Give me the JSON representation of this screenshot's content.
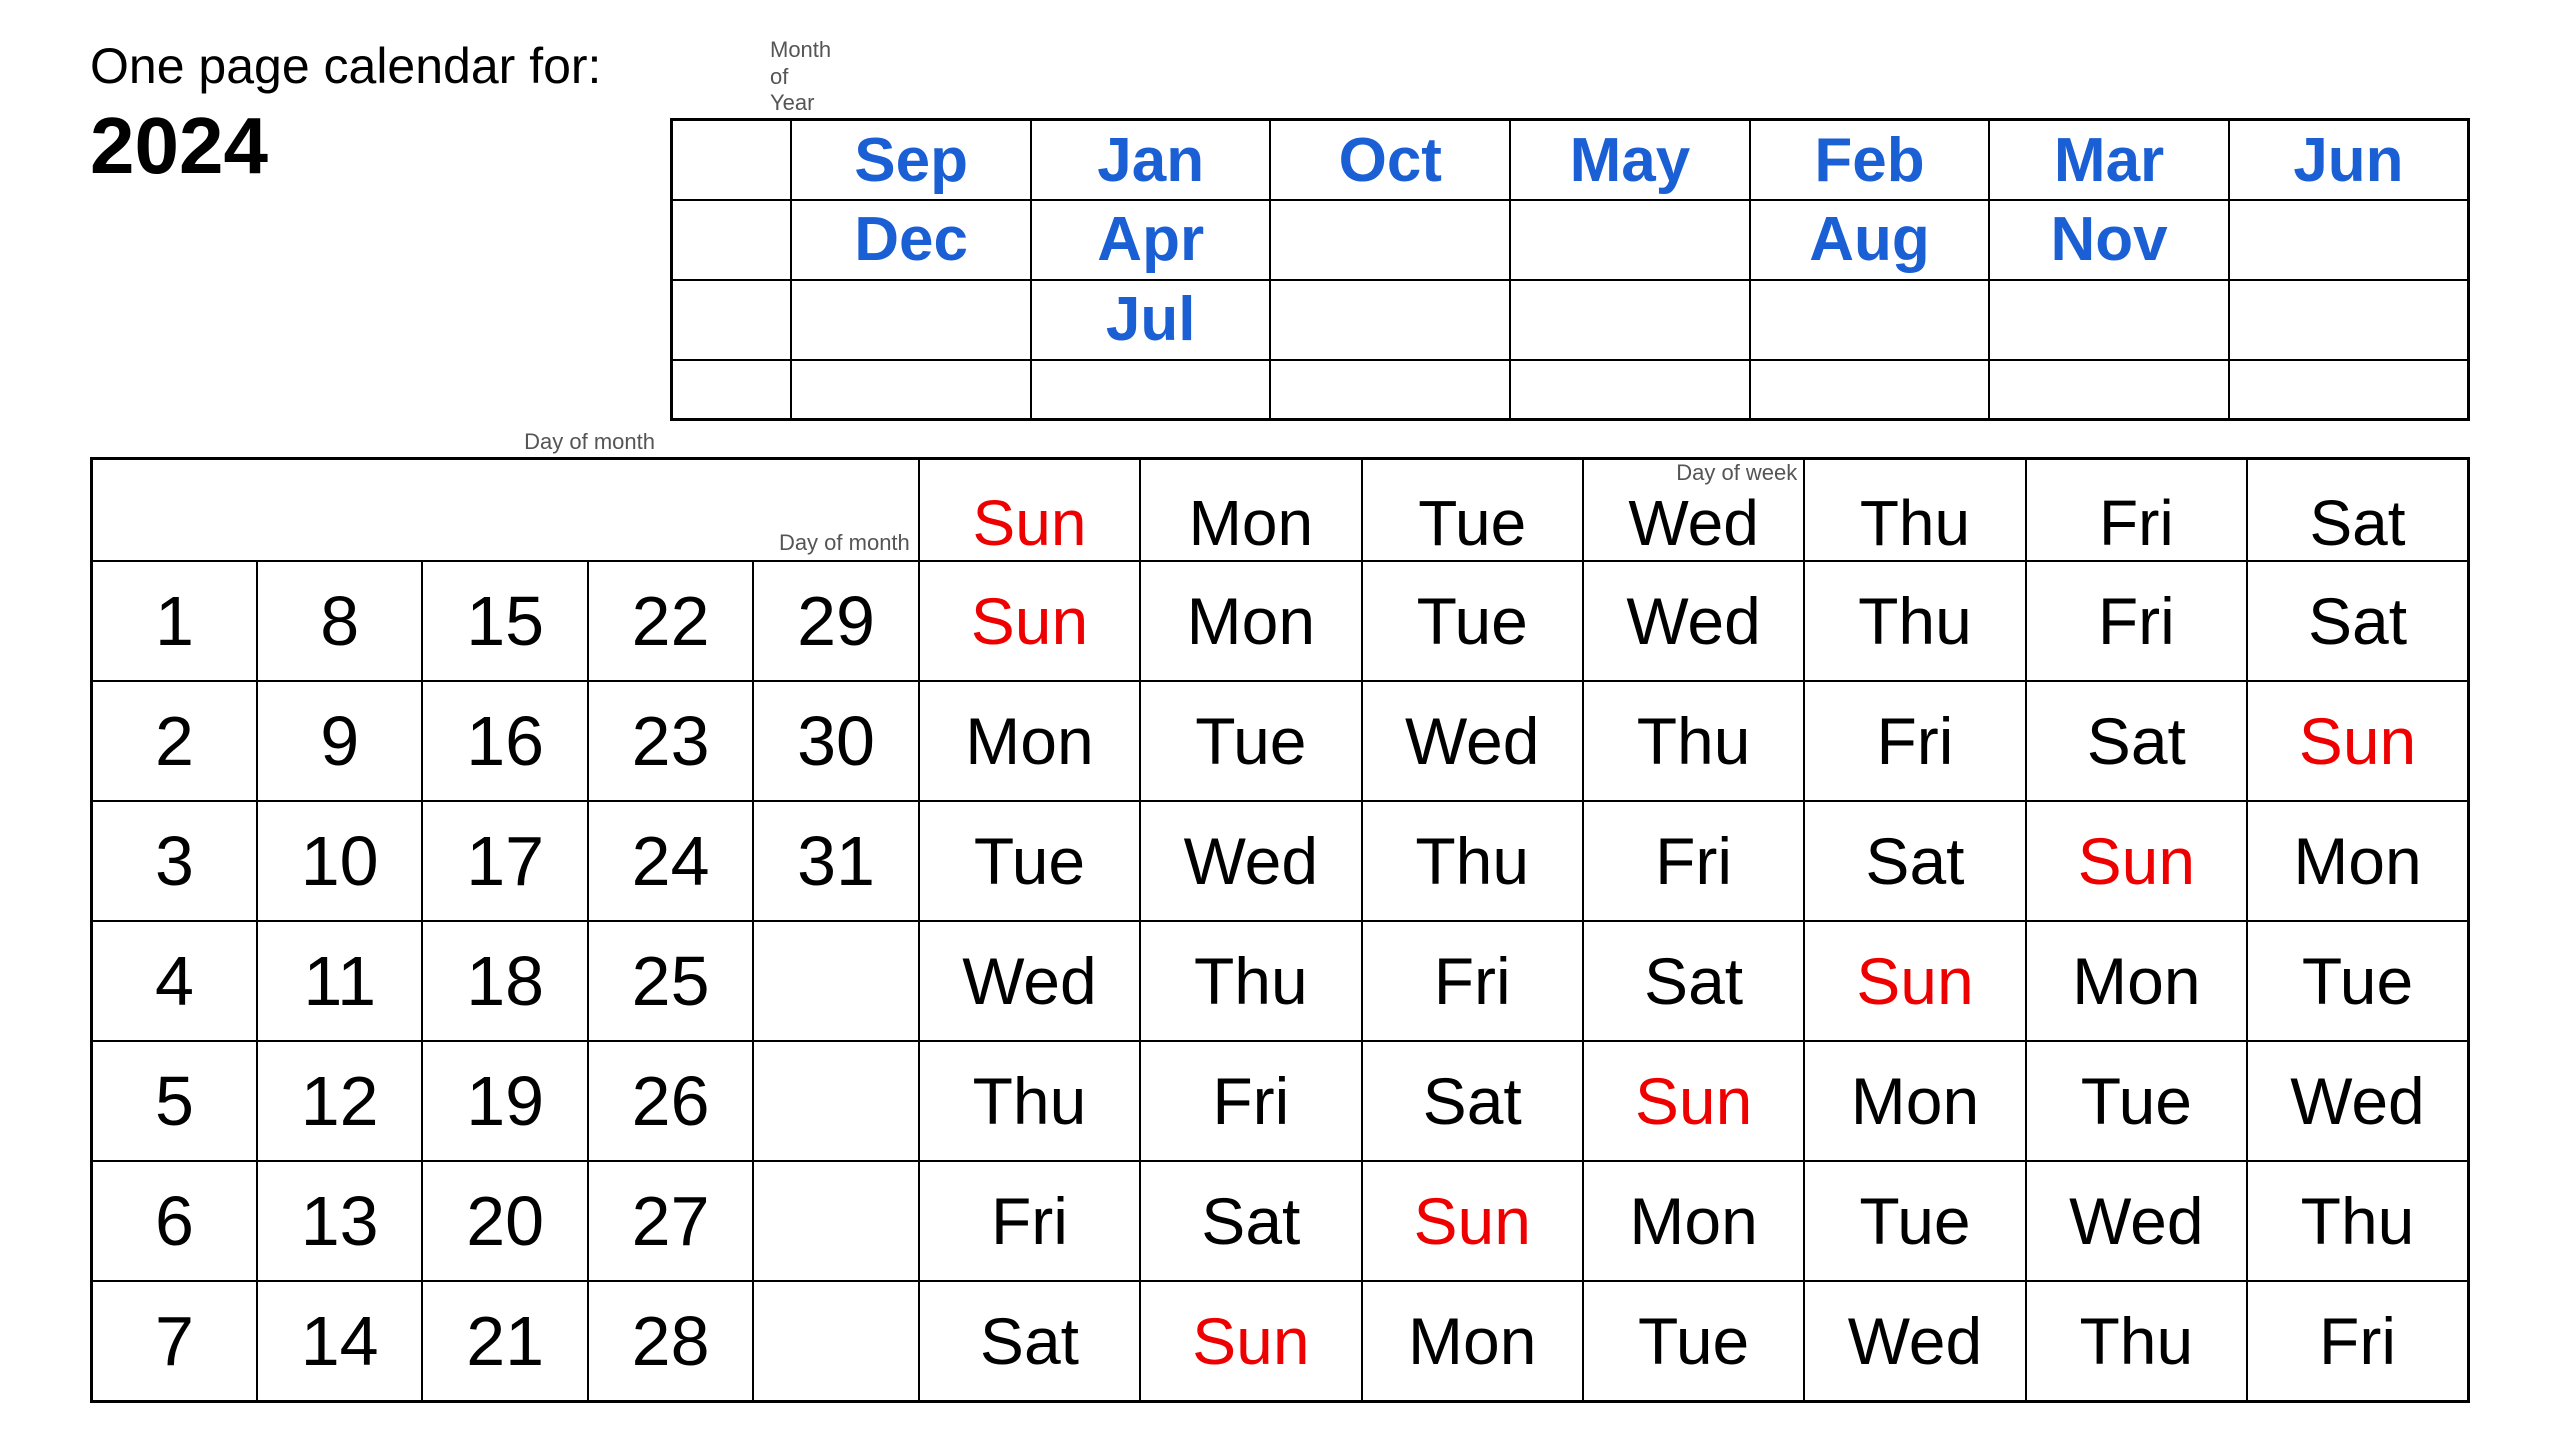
{
  "title": {
    "line1": "One page calendar for:",
    "line2": "2024"
  },
  "labels": {
    "month_of_year": "Month\nof\nYear",
    "day_of_month": "Day of month",
    "day_of_week": "Day of week"
  },
  "month_rows": [
    [
      "Sep",
      "Jan",
      "Oct",
      "May",
      "Feb",
      "Mar",
      "Jun"
    ],
    [
      "Dec",
      "Apr",
      "",
      "",
      "Aug",
      "Nov",
      ""
    ],
    [
      "",
      "Jul",
      "",
      "",
      "",
      "",
      ""
    ],
    [
      "",
      "",
      "",
      "",
      "",
      "",
      ""
    ]
  ],
  "day_numbers": [
    [
      1,
      8,
      15,
      22,
      29
    ],
    [
      2,
      9,
      16,
      23,
      30
    ],
    [
      3,
      10,
      17,
      24,
      31
    ],
    [
      4,
      11,
      18,
      25,
      ""
    ],
    [
      5,
      12,
      19,
      26,
      ""
    ],
    [
      6,
      13,
      20,
      27,
      ""
    ],
    [
      7,
      14,
      21,
      28,
      ""
    ]
  ],
  "day_of_week_header": [
    "Sun",
    "Mon",
    "Tue",
    "Wed",
    "Thu",
    "Fri",
    "Sat"
  ],
  "day_of_week_header_colors": [
    "red",
    "black",
    "black",
    "black",
    "black",
    "black",
    "black"
  ],
  "day_grid": [
    [
      "Mon",
      "Tue",
      "Wed",
      "Thu",
      "Fri",
      "Sat",
      "Sun"
    ],
    [
      "Tue",
      "Wed",
      "Thu",
      "Fri",
      "Sat",
      "Sun",
      "Mon"
    ],
    [
      "Wed",
      "Thu",
      "Fri",
      "Sat",
      "Sun",
      "Mon",
      "Tue"
    ],
    [
      "Thu",
      "Fri",
      "Sat",
      "Sun",
      "Mon",
      "Tue",
      "Wed"
    ],
    [
      "Fri",
      "Sat",
      "Sun",
      "Mon",
      "Tue",
      "Wed",
      "Thu"
    ],
    [
      "Sat",
      "Sun",
      "Mon",
      "Tue",
      "Wed",
      "Thu",
      "Fri"
    ]
  ],
  "day_grid_colors": [
    [
      "black",
      "black",
      "black",
      "black",
      "black",
      "black",
      "red"
    ],
    [
      "black",
      "black",
      "black",
      "black",
      "black",
      "black",
      "red"
    ],
    [
      "black",
      "black",
      "black",
      "black",
      "red",
      "black",
      "black"
    ],
    [
      "black",
      "black",
      "black",
      "red",
      "black",
      "black",
      "black"
    ],
    [
      "black",
      "black",
      "red",
      "black",
      "black",
      "black",
      "black"
    ],
    [
      "black",
      "red",
      "black",
      "black",
      "black",
      "black",
      "black"
    ]
  ]
}
